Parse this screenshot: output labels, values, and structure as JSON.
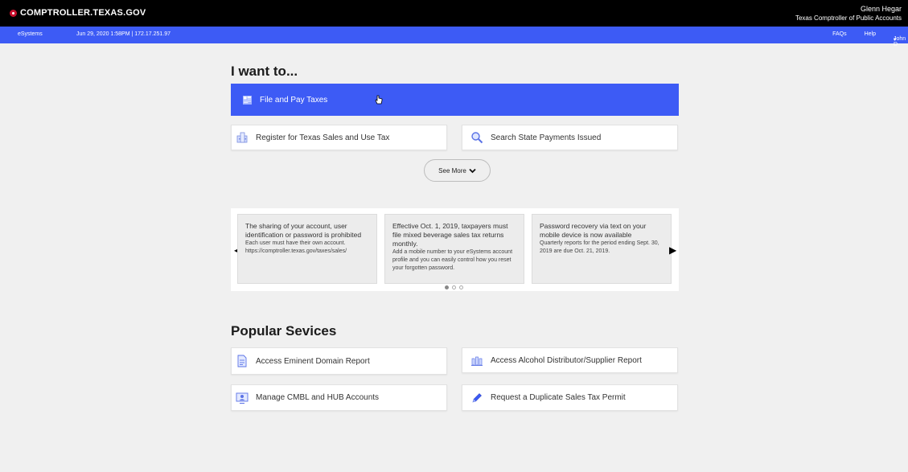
{
  "header": {
    "logo_text": "COMPTROLLER.TEXAS.GOV",
    "official_name": "Glenn Hegar",
    "official_title": "Texas Comptroller of Public Accounts"
  },
  "navbar": {
    "app_name": "eSystems",
    "session_info": "Jun 29, 2020 1:58PM  |  172.17.251.97",
    "faqs": "FAQs",
    "help": "Help",
    "user": "John D"
  },
  "iwant": {
    "heading": "I want to...",
    "primary_action": "File and Pay Taxes",
    "actions": [
      {
        "label": "Register for Texas Sales and Use Tax",
        "icon": "building-icon"
      },
      {
        "label": "Search State Payments Issued",
        "icon": "magnify-icon"
      }
    ],
    "see_more": "See More"
  },
  "carousel": {
    "slides": [
      {
        "headline": "The sharing of your account, user identification or password is prohibited",
        "body": "Each user must have their own account. https://comptroller.texas.gov/taxes/sales/"
      },
      {
        "headline": "Effective Oct. 1, 2019, taxpayers must file mixed beverage sales tax returns monthly.",
        "body": "Add a mobile number to your eSystems account profile and you can easily control how you reset your forgotten password."
      },
      {
        "headline": "Password recovery via text on your mobile device is now available",
        "body": "Quarterly reports for the period ending Sept. 30, 2019 are due Oct. 21, 2019."
      }
    ],
    "active_page": 1,
    "page_count": 3
  },
  "popular": {
    "heading": "Popular Sevices",
    "items": [
      {
        "label": "Access Eminent Domain Report",
        "icon": "document-icon"
      },
      {
        "label": "Access Alcohol Distributor/Supplier Report",
        "icon": "bottles-icon"
      },
      {
        "label": "Manage CMBL and HUB Accounts",
        "icon": "monitor-user-icon"
      },
      {
        "label": "Request a Duplicate Sales Tax Permit",
        "icon": "pencil-icon"
      }
    ]
  },
  "colors": {
    "accent": "#3d5bf5",
    "topbar": "#000000",
    "logo_star": "#c8102e"
  }
}
